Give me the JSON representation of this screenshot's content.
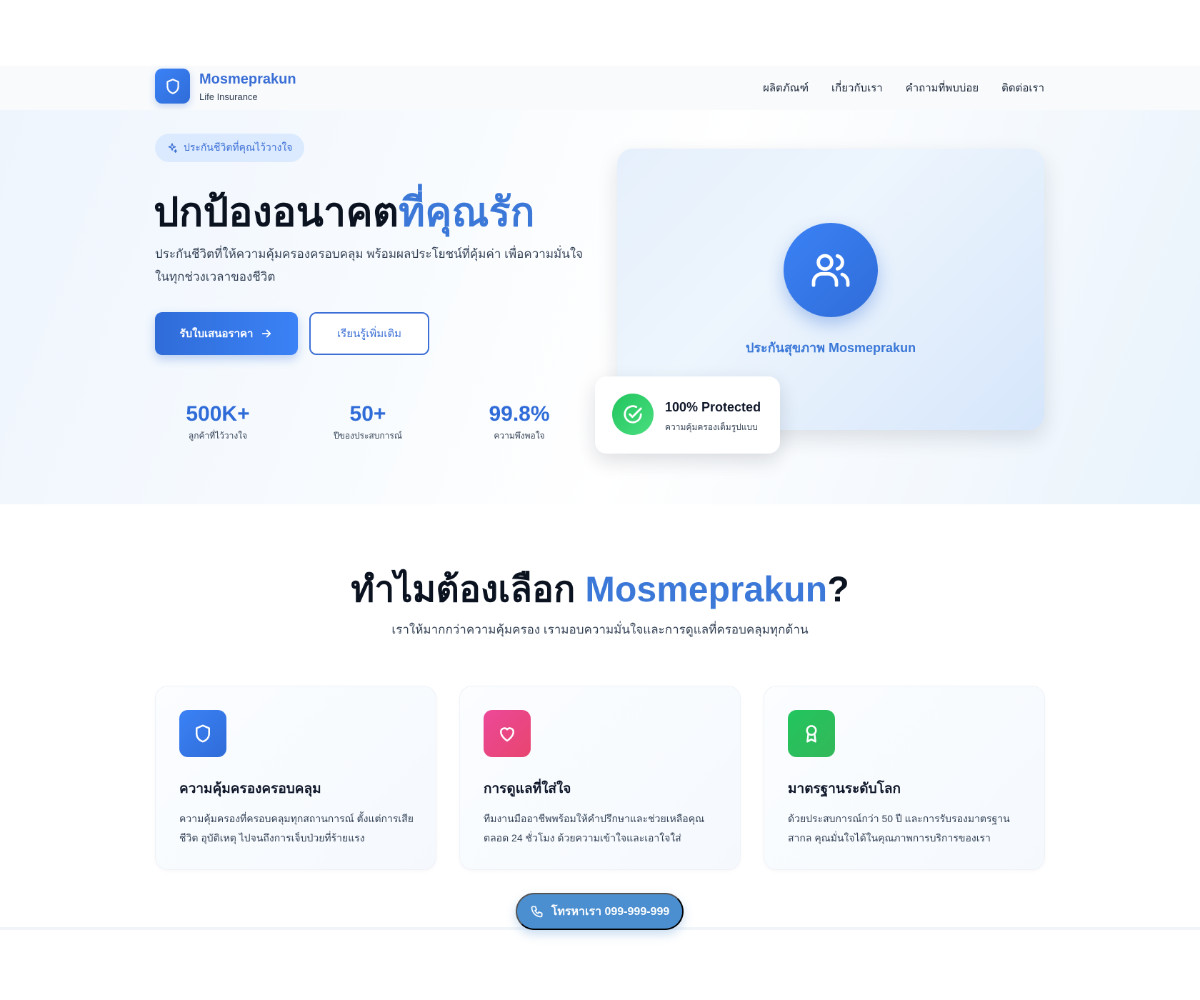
{
  "brand": {
    "name": "Mosmeprakun",
    "tagline": "Life Insurance"
  },
  "nav": {
    "items": [
      "ผลิตภัณฑ์",
      "เกี่ยวกับเรา",
      "คำถามที่พบบ่อย",
      "ติดต่อเรา"
    ]
  },
  "hero": {
    "badge": "ประกันชีวิตที่คุณไว้วางใจ",
    "title_main": "ปกป้องอนาคต",
    "title_accent": "ที่คุณรัก",
    "description": "ประกันชีวิตที่ให้ความคุ้มครองครอบคลุม พร้อมผลประโยชน์ที่คุ้มค่า เพื่อความมั่นใจในทุกช่วงเวลาของชีวิต",
    "primary_button": "รับใบเสนอราคา",
    "secondary_button": "เรียนรู้เพิ่มเติม",
    "stats": [
      {
        "value": "500K+",
        "label": "ลูกค้าที่ไว้วางใจ"
      },
      {
        "value": "50+",
        "label": "ปีของประสบการณ์"
      },
      {
        "value": "99.8%",
        "label": "ความพึงพอใจ"
      }
    ],
    "card_caption": "ประกันสุขภาพ Mosmeprakun",
    "protected_title": "100% Protected",
    "protected_sub": "ความคุ้มครองเต็มรูปแบบ"
  },
  "why": {
    "title_main": "ทำไมต้องเลือก ",
    "title_accent": "Mosmeprakun",
    "title_end": "?",
    "subtitle": "เราให้มากกว่าความคุ้มครอง เรามอบความมั่นใจและการดูแลที่ครอบคลุมทุกด้าน",
    "features": [
      {
        "icon": "shield-icon",
        "color": "#3b78d8",
        "title": "ความคุ้มครองครอบคลุม",
        "desc": "ความคุ้มครองที่ครอบคลุมทุกสถานการณ์ ตั้งแต่การเสียชีวิต อุบัติเหตุ ไปจนถึงการเจ็บป่วยที่ร้ายแรง"
      },
      {
        "icon": "heart-icon",
        "color": "#e8456f",
        "title": "การดูแลที่ใส่ใจ",
        "desc": "ทีมงานมืออาชีพพร้อมให้คำปรึกษาและช่วยเหลือคุณตลอด 24 ชั่วโมง ด้วยความเข้าใจและเอาใจใส่"
      },
      {
        "icon": "award-icon",
        "color": "#34b85a",
        "title": "มาตรฐานระดับโลก",
        "desc": "ด้วยประสบการณ์กว่า 50 ปี และการรับรองมาตรฐานสากล คุณมั่นใจได้ในคุณภาพการบริการของเรา"
      }
    ]
  },
  "call_button": "โทรหาเรา 099-999-999",
  "colors": {
    "primary": "#2f6cd8",
    "accent": "#3b78d8",
    "success": "#22c55e"
  }
}
